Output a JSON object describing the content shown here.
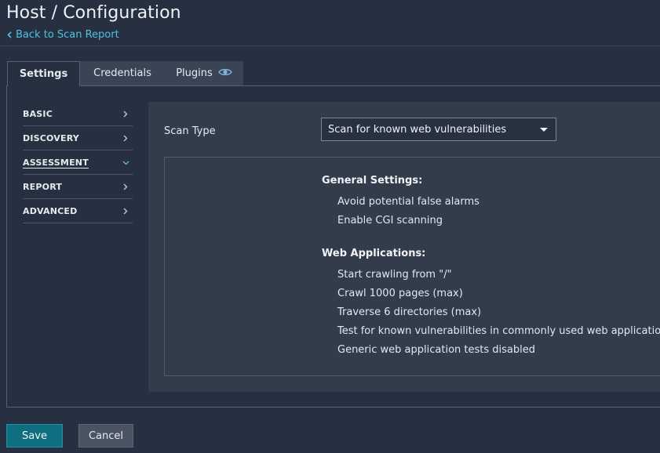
{
  "page": {
    "title": "Host / Configuration",
    "back_link": "Back to Scan Report"
  },
  "tabs": [
    {
      "label": "Settings",
      "active": true
    },
    {
      "label": "Credentials",
      "active": false
    },
    {
      "label": "Plugins",
      "active": false,
      "icon": "eye-icon"
    }
  ],
  "sidebar": {
    "items": [
      {
        "label": "BASIC",
        "icon": "chevron-right-icon"
      },
      {
        "label": "DISCOVERY",
        "icon": "chevron-right-icon"
      },
      {
        "label": "ASSESSMENT",
        "icon": "chevron-down-icon",
        "active": true
      },
      {
        "label": "REPORT",
        "icon": "chevron-right-icon"
      },
      {
        "label": "ADVANCED",
        "icon": "chevron-right-icon"
      }
    ]
  },
  "scan_type": {
    "label": "Scan Type",
    "value": "Scan for known web vulnerabilities"
  },
  "summary": {
    "general": {
      "heading": "General Settings:",
      "items": [
        "Avoid potential false alarms",
        "Enable CGI scanning"
      ]
    },
    "web": {
      "heading": "Web Applications:",
      "items": [
        "Start crawling from \"/\"",
        "Crawl 1000 pages (max)",
        "Traverse 6 directories (max)",
        "Test for known vulnerabilities in commonly used web applications",
        "Generic web application tests disabled"
      ]
    }
  },
  "buttons": {
    "save": "Save",
    "cancel": "Cancel"
  },
  "colors": {
    "background": "#263040",
    "panel": "#323c4b",
    "accent_link": "#4ec3e0",
    "save_button": "#0e6f80"
  }
}
